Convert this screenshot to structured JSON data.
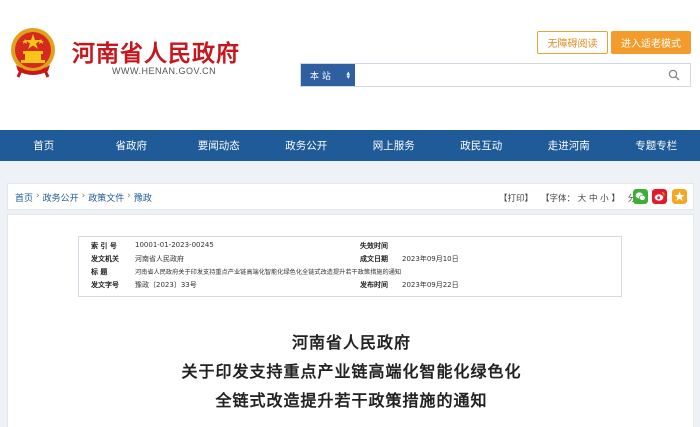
{
  "header": {
    "site_title": "河南省人民政府",
    "site_url": "WWW.HENAN.GOV.CN",
    "accessibility_label": "无障碍阅读",
    "elder_mode_label": "进入适老模式",
    "search": {
      "scope_label": "本 站",
      "value": "",
      "placeholder": ""
    }
  },
  "nav": {
    "items": [
      "首页",
      "省政府",
      "要闻动态",
      "政务公开",
      "网上服务",
      "政民互动",
      "走进河南",
      "专题专栏"
    ]
  },
  "breadcrumb": {
    "items": [
      "首页",
      "政务公开",
      "政策文件",
      "豫政"
    ],
    "separator": "›"
  },
  "tools": {
    "print": "【打印】",
    "font": "【字体：",
    "font_large": "大",
    "font_medium": "中",
    "font_small": "小",
    "font_close": "】",
    "share": "分享："
  },
  "meta": {
    "index_label": "索 引 号",
    "index_value": "10001-01-2023-00245",
    "expire_label": "失效时间",
    "expire_value": "",
    "issuer_label": "发文机关",
    "issuer_value": "河南省人民政府",
    "date_label": "成文日期",
    "date_value": "2023年09月10日",
    "title_label": "标 题",
    "title_value": "河南省人民政府关于印发支持重点产业链高端化智能化绿色化全链式改造提升若干政策措施的通知",
    "docno_label": "发文字号",
    "docno_value": "豫政〔2023〕33号",
    "publish_label": "发布时间",
    "publish_value": "2023年09月22日"
  },
  "document": {
    "title_line1": "河南省人民政府",
    "title_line2": "关于印发支持重点产业链高端化智能化绿色化",
    "title_line3": "全链式改造提升若干政策措施的通知"
  },
  "colors": {
    "brand_red": "#c8161d",
    "nav_blue": "#1f5b99",
    "accent_orange": "#f39c2c"
  }
}
